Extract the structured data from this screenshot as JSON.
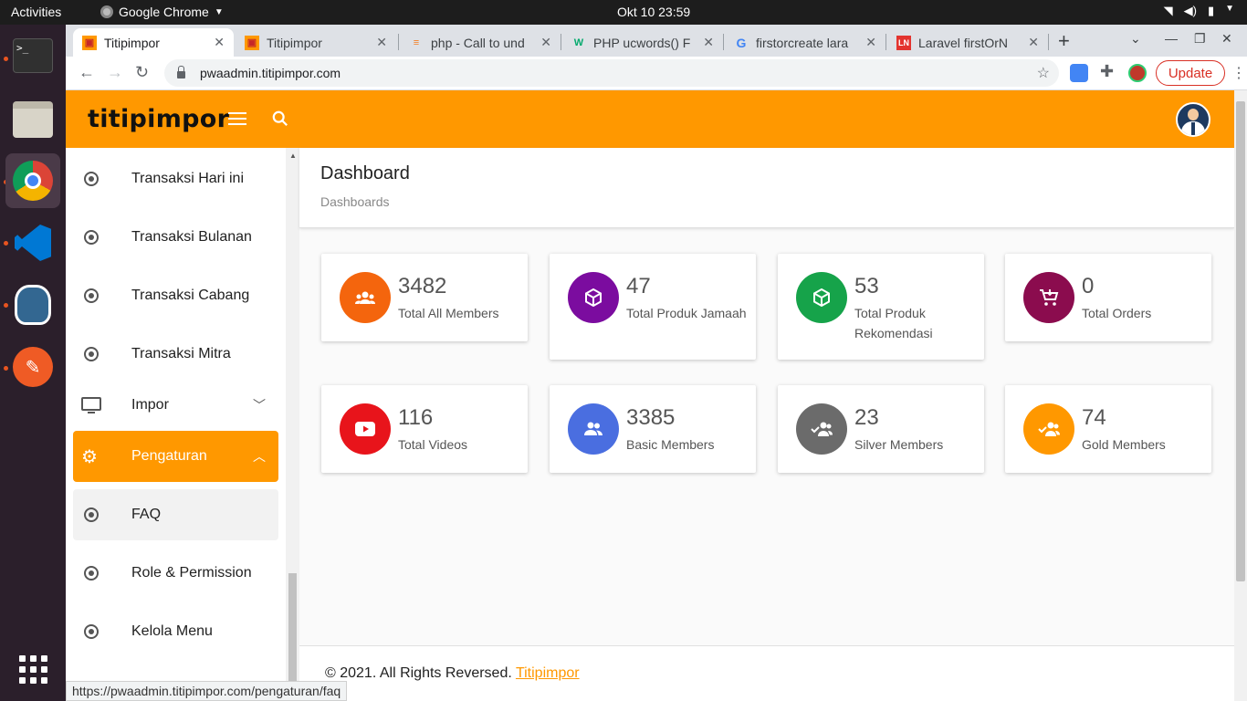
{
  "topbar": {
    "activities": "Activities",
    "app_name": "Google Chrome",
    "clock": "Okt 10  23:59"
  },
  "tabs": [
    {
      "title": "Titipimpor",
      "favicon": "titipimpor-favicon"
    },
    {
      "title": "Titipimpor",
      "favicon": "titipimpor-favicon"
    },
    {
      "title": "php - Call to und",
      "favicon": "stackoverflow-favicon"
    },
    {
      "title": "PHP ucwords() F",
      "favicon": "w3schools-favicon"
    },
    {
      "title": "firstorcreate lara",
      "favicon": "google-favicon"
    },
    {
      "title": "Laravel firstOrN",
      "favicon": "laravel-news-favicon"
    }
  ],
  "address_bar": {
    "url": "pwaadmin.titipimpor.com",
    "update_label": "Update"
  },
  "header": {
    "logo_text": "titipimpor"
  },
  "sidebar": {
    "items": [
      {
        "label": "Transaksi Hari ini",
        "icon": "radio-icon"
      },
      {
        "label": "Transaksi Bulanan",
        "icon": "radio-icon"
      },
      {
        "label": "Transaksi Cabang",
        "icon": "radio-icon"
      },
      {
        "label": "Transaksi Mitra",
        "icon": "radio-icon"
      },
      {
        "label": "Impor",
        "icon": "monitor-icon",
        "expandable": true
      },
      {
        "label": "Pengaturan",
        "icon": "gear-icon",
        "expandable": true,
        "expanded": true
      },
      {
        "label": "FAQ",
        "icon": "radio-icon"
      },
      {
        "label": "Role & Permission",
        "icon": "radio-icon"
      },
      {
        "label": "Kelola Menu",
        "icon": "radio-icon"
      }
    ]
  },
  "page": {
    "title": "Dashboard",
    "breadcrumb": "Dashboards"
  },
  "stats": [
    {
      "value": "3482",
      "label": "Total All Members",
      "color": "#f4650d",
      "icon": "group-icon"
    },
    {
      "value": "47",
      "label": "Total Produk Jamaah",
      "color": "#7b0c9f",
      "icon": "box-icon"
    },
    {
      "value": "53",
      "label": "Total Produk Rekomendasi",
      "color": "#16a34a",
      "icon": "box-icon"
    },
    {
      "value": "0",
      "label": "Total Orders",
      "color": "#8b0c4e",
      "icon": "cart-icon"
    },
    {
      "value": "116",
      "label": "Total Videos",
      "color": "#e8141b",
      "icon": "youtube-icon"
    },
    {
      "value": "3385",
      "label": "Basic Members",
      "color": "#4a6ee0",
      "icon": "people-icon"
    },
    {
      "value": "23",
      "label": "Silver Members",
      "color": "#6b6b6b",
      "icon": "group-check-icon"
    },
    {
      "value": "74",
      "label": "Gold Members",
      "color": "#ff9800",
      "icon": "group-check-icon"
    }
  ],
  "footer": {
    "text": "© 2021. All Rights Reversed.",
    "link": "Titipimpor"
  },
  "status_url": "https://pwaadmin.titipimpor.com/pengaturan/faq",
  "colors": {
    "primary": "#ff9800",
    "update": "#d93025"
  }
}
